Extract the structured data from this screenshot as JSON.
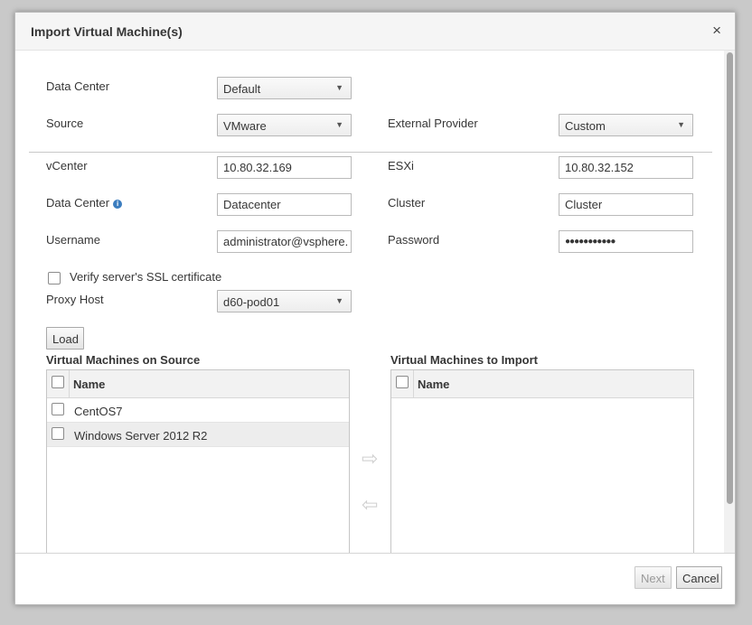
{
  "dialog": {
    "title": "Import Virtual Machine(s)",
    "close_glyph": "×"
  },
  "form": {
    "data_center_label": "Data Center",
    "data_center_value": "Default",
    "source_label": "Source",
    "source_value": "VMware",
    "external_provider_label": "External Provider",
    "external_provider_value": "Custom",
    "vcenter_label": "vCenter",
    "vcenter_value": "10.80.32.169",
    "esxi_label": "ESXi",
    "esxi_value": "10.80.32.152",
    "dc2_label": "Data Center",
    "dc2_value": "Datacenter",
    "cluster_label": "Cluster",
    "cluster_value": "Cluster",
    "username_label": "Username",
    "username_value": "administrator@vsphere.",
    "password_label": "Password",
    "password_value": "●●●●●●●●●●●",
    "verify_ssl_label": "Verify server's SSL certificate",
    "verify_ssl_checked": false,
    "proxy_host_label": "Proxy Host",
    "proxy_host_value": "d60-pod01",
    "load_button": "Load"
  },
  "source_list": {
    "title": "Virtual Machines on Source",
    "column": "Name",
    "rows": [
      "CentOS7",
      "Windows Server 2012 R2"
    ]
  },
  "import_list": {
    "title": "Virtual Machines to Import",
    "column": "Name",
    "rows": []
  },
  "footer": {
    "next_button": "Next",
    "cancel_button": "Cancel"
  },
  "icons": {
    "caret": "⌄",
    "info": "i",
    "arrow_right": "⇨",
    "arrow_left": "⇦"
  },
  "colors": {
    "info_icon": "#3b7dbf",
    "overlay": "#c9c9c9"
  }
}
